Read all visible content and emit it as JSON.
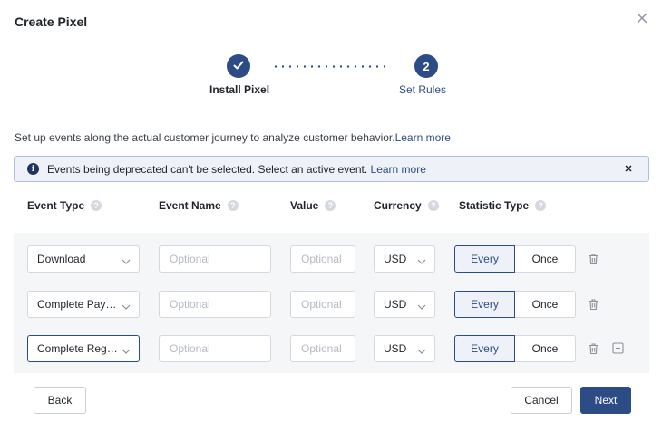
{
  "dialog": {
    "title": "Create Pixel",
    "close_icon": "close-icon"
  },
  "steps": [
    {
      "number": "✓",
      "label": "Install Pixel",
      "status": "completed"
    },
    {
      "number": "2",
      "label": "Set Rules",
      "status": "active"
    }
  ],
  "description": {
    "text": "Set up events along the actual customer journey to analyze customer behavior.",
    "link": "Learn more"
  },
  "notice": {
    "icon": "info-icon",
    "text": "Events being deprecated can't be selected. Select an active event.",
    "link": "Learn more"
  },
  "columns": {
    "event_type": "Event Type",
    "event_name": "Event Name",
    "value": "Value",
    "currency": "Currency",
    "statistic_type": "Statistic Type",
    "help_glyph": "?"
  },
  "rows": [
    {
      "event_type": "Download",
      "event_name_placeholder": "Optional",
      "value_placeholder": "Optional",
      "currency": "USD",
      "statistic_options": [
        "Every",
        "Once"
      ],
      "selected": "Every"
    },
    {
      "event_type": "Complete Pay…",
      "event_name_placeholder": "Optional",
      "value_placeholder": "Optional",
      "currency": "USD",
      "statistic_options": [
        "Every",
        "Once"
      ],
      "selected": "Every"
    },
    {
      "event_type": "Complete Reg…",
      "event_name_placeholder": "Optional",
      "value_placeholder": "Optional",
      "currency": "USD",
      "statistic_options": [
        "Every",
        "Once"
      ],
      "selected": "Every"
    }
  ],
  "footer": {
    "back": "Back",
    "cancel": "Cancel",
    "next": "Next"
  },
  "colors": {
    "primary": "#2d4b85",
    "notice_bg": "#eef2f8",
    "panel_bg": "#f5f6f8"
  }
}
